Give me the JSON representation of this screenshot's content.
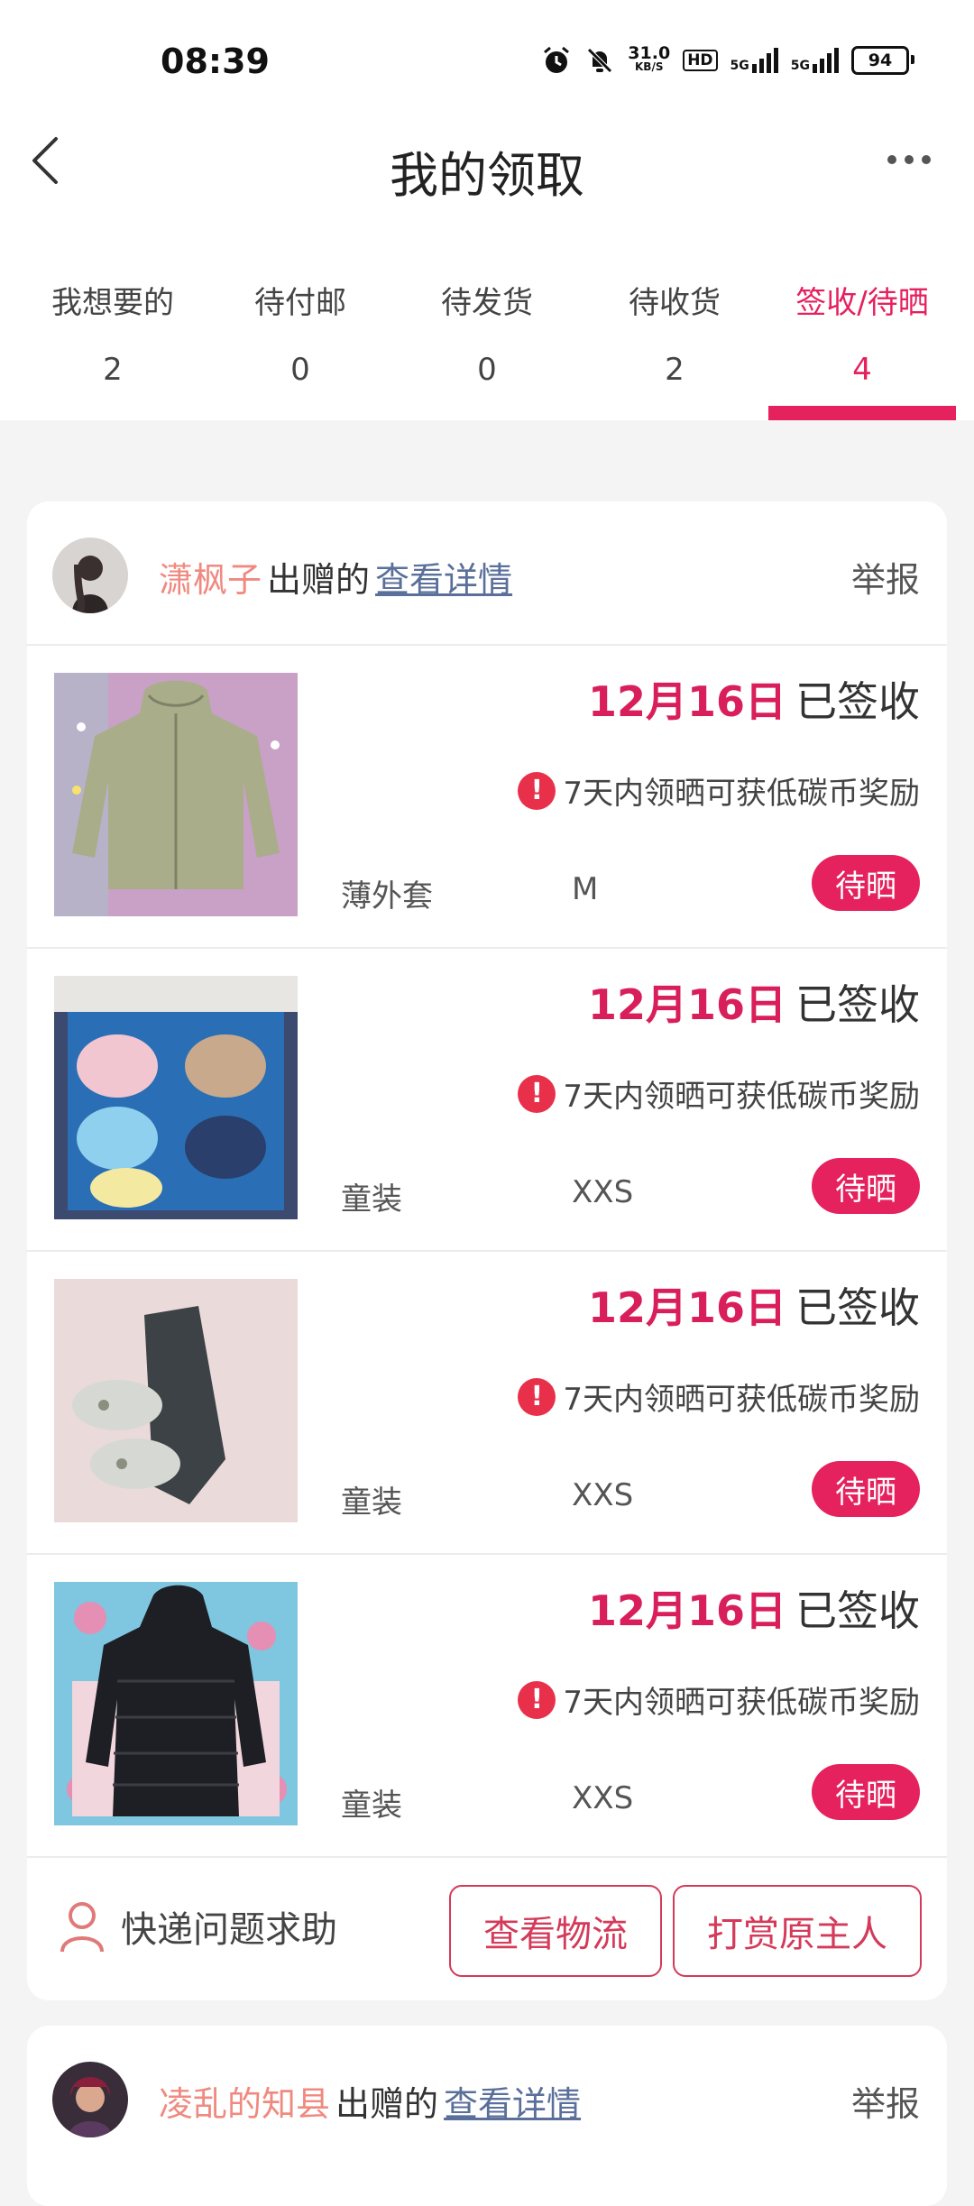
{
  "status_bar": {
    "time": "08:39",
    "net_speed_value": "31.0",
    "net_speed_unit": "KB/S",
    "hd_label": "HD",
    "signal1_label": "5G",
    "signal2_label": "5G",
    "battery": "94"
  },
  "header": {
    "title": "我的领取"
  },
  "tabs": [
    {
      "label": "我想要的",
      "count": "2"
    },
    {
      "label": "待付邮",
      "count": "0"
    },
    {
      "label": "待发货",
      "count": "0"
    },
    {
      "label": "待收货",
      "count": "2"
    },
    {
      "label": "签收/待晒",
      "count": "4",
      "active": true
    }
  ],
  "cards": [
    {
      "giver": "潇枫子",
      "giver_suffix": "出赠的",
      "detail_link": "查看详情",
      "report": "举报",
      "items": [
        {
          "date": "12月16日",
          "status": "已签收",
          "notice": "7天内领晒可获低碳币奖励",
          "category": "薄外套",
          "size": "M",
          "badge": "待晒"
        },
        {
          "date": "12月16日",
          "status": "已签收",
          "notice": "7天内领晒可获低碳币奖励",
          "category": "童装",
          "size": "XXS",
          "badge": "待晒"
        },
        {
          "date": "12月16日",
          "status": "已签收",
          "notice": "7天内领晒可获低碳币奖励",
          "category": "童装",
          "size": "XXS",
          "badge": "待晒"
        },
        {
          "date": "12月16日",
          "status": "已签收",
          "notice": "7天内领晒可获低碳币奖励",
          "category": "童装",
          "size": "XXS",
          "badge": "待晒"
        }
      ],
      "footer": {
        "help": "快递问题求助",
        "logistics_button": "查看物流",
        "reward_button": "打赏原主人"
      }
    },
    {
      "giver": "凌乱的知县",
      "giver_suffix": "出赠的",
      "detail_link": "查看详情",
      "report": "举报"
    }
  ],
  "colors": {
    "accent": "#e5215e",
    "giver_name": "#f08a80",
    "link": "#5a6f9a",
    "background": "#f4f4f4"
  }
}
